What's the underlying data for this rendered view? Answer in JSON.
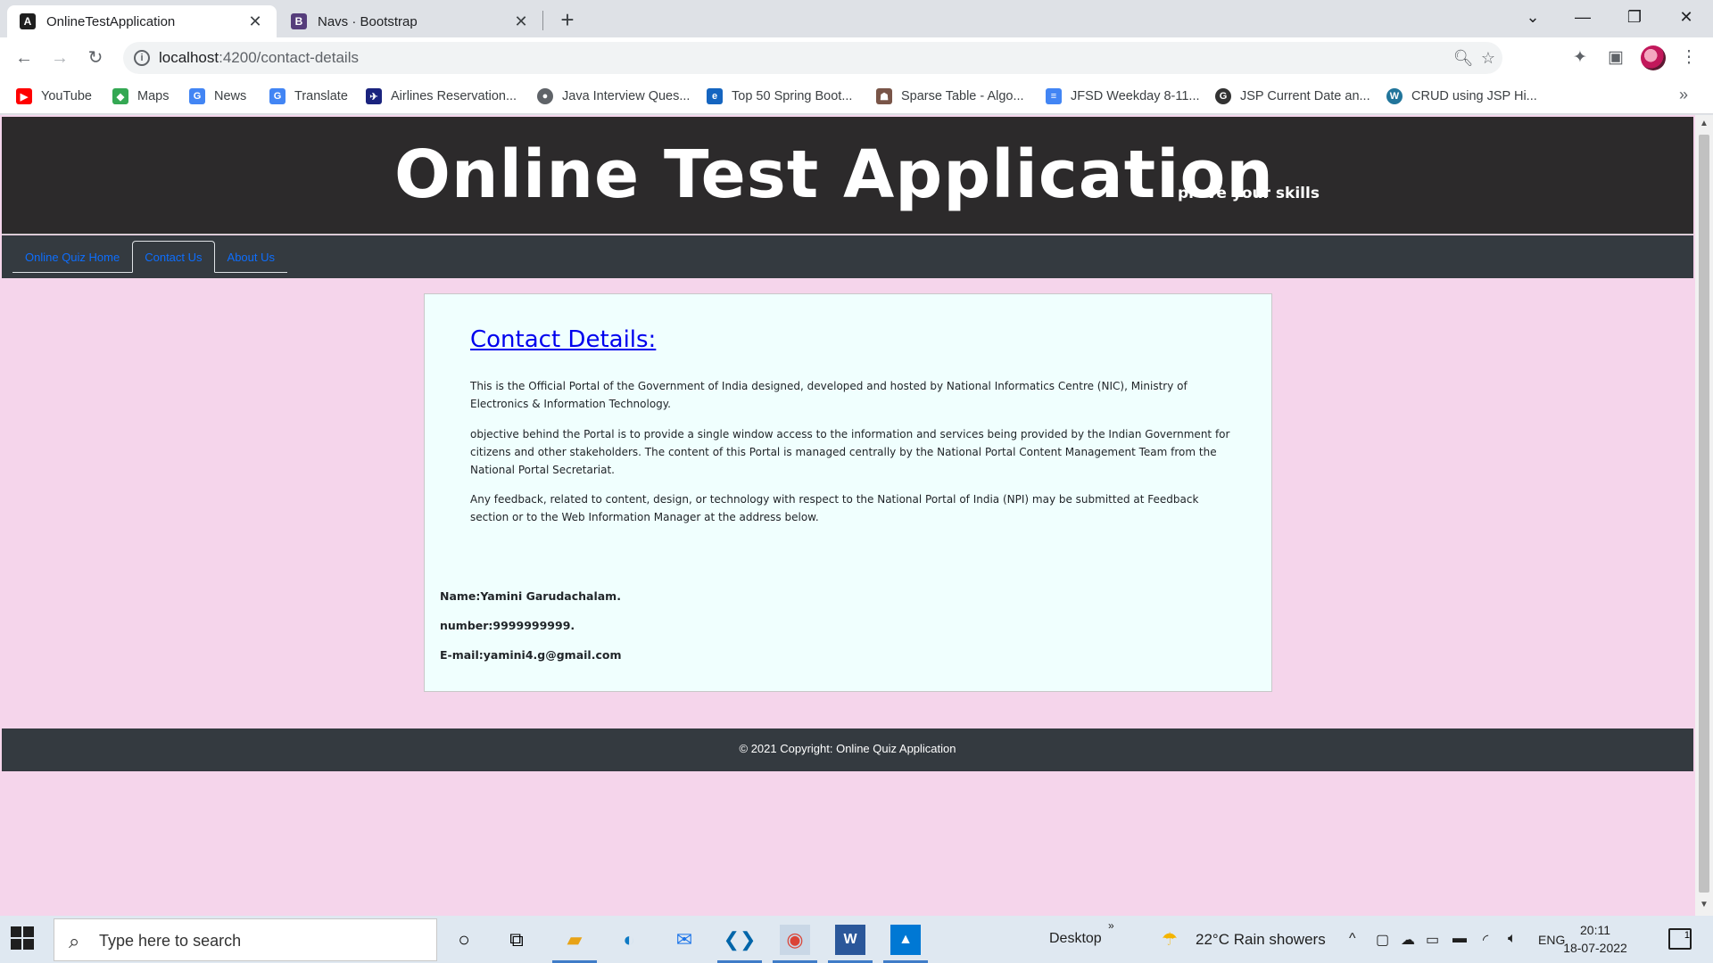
{
  "browser": {
    "tabs": [
      {
        "title": "OnlineTestApplication",
        "active": true,
        "favicon": "angular-icon"
      },
      {
        "title": "Navs · Bootstrap",
        "active": false,
        "favicon": "bootstrap-icon"
      }
    ],
    "new_tab_label": "+",
    "url_host": "localhost",
    "url_path": ":4200/contact-details",
    "bookmarks": [
      {
        "label": "YouTube",
        "icon": "youtube-icon",
        "color": "#ff0000"
      },
      {
        "label": "Maps",
        "icon": "maps-icon",
        "color": "#34a853"
      },
      {
        "label": "News",
        "icon": "news-icon",
        "color": "#4285f4"
      },
      {
        "label": "Translate",
        "icon": "translate-icon",
        "color": "#4285f4"
      },
      {
        "label": "Airlines Reservation...",
        "icon": "airlines-icon",
        "color": "#1a237e"
      },
      {
        "label": "Java Interview Ques...",
        "icon": "globe-icon",
        "color": "#5f6368"
      },
      {
        "label": "Top 50 Spring Boot...",
        "icon": "edureka-icon",
        "color": "#1565c0"
      },
      {
        "label": "Sparse Table - Algo...",
        "icon": "algo-icon",
        "color": "#795548"
      },
      {
        "label": "JFSD Weekday 8-11...",
        "icon": "docs-icon",
        "color": "#4285f4"
      },
      {
        "label": "JSP Current Date an...",
        "icon": "jsp-icon",
        "color": "#333333"
      },
      {
        "label": "CRUD using JSP Hi...",
        "icon": "wordpress-icon",
        "color": "#21759b"
      }
    ],
    "more_bookmarks": "»"
  },
  "site": {
    "title": "Online Test Application",
    "tagline": "prove your skills",
    "nav": [
      {
        "label": "Online Quiz Home",
        "active": false
      },
      {
        "label": "Contact Us",
        "active": true
      },
      {
        "label": "About Us",
        "active": false
      }
    ],
    "contact": {
      "heading": "Contact Details:",
      "paragraphs": [
        "This is the Official Portal of the Government of India designed, developed and hosted by National Informatics Centre (NIC), Ministry of Electronics & Information Technology.",
        "objective behind the Portal is to provide a single window access to the information and services being provided by the Indian Government for citizens and other stakeholders. The content of this Portal is managed centrally by the National Portal Content Management Team from the National Portal Secretariat.",
        "Any feedback, related to content, design, or technology with respect to the National Portal of India (NPI) may be submitted at Feedback section or to the Web Information Manager at the address below."
      ],
      "name": "Name:Yamini Garudachalam.",
      "number": "number:9999999999.",
      "email": "E-mail:yamini4.g@gmail.com"
    },
    "footer": "© 2021 Copyright: Online Quiz Application"
  },
  "taskbar": {
    "search_placeholder": "Type here to search",
    "desktop_label": "Desktop",
    "weather": "22°C  Rain showers",
    "language": "ENG",
    "time": "20:11",
    "date": "18-07-2022",
    "notification_count": "1"
  },
  "colors": {
    "page_background": "#f5d5eb",
    "header_background": "#2c2a2b",
    "nav_background": "#343a40",
    "card_background": "#f0fffe",
    "link_color": "#0d6efd"
  }
}
